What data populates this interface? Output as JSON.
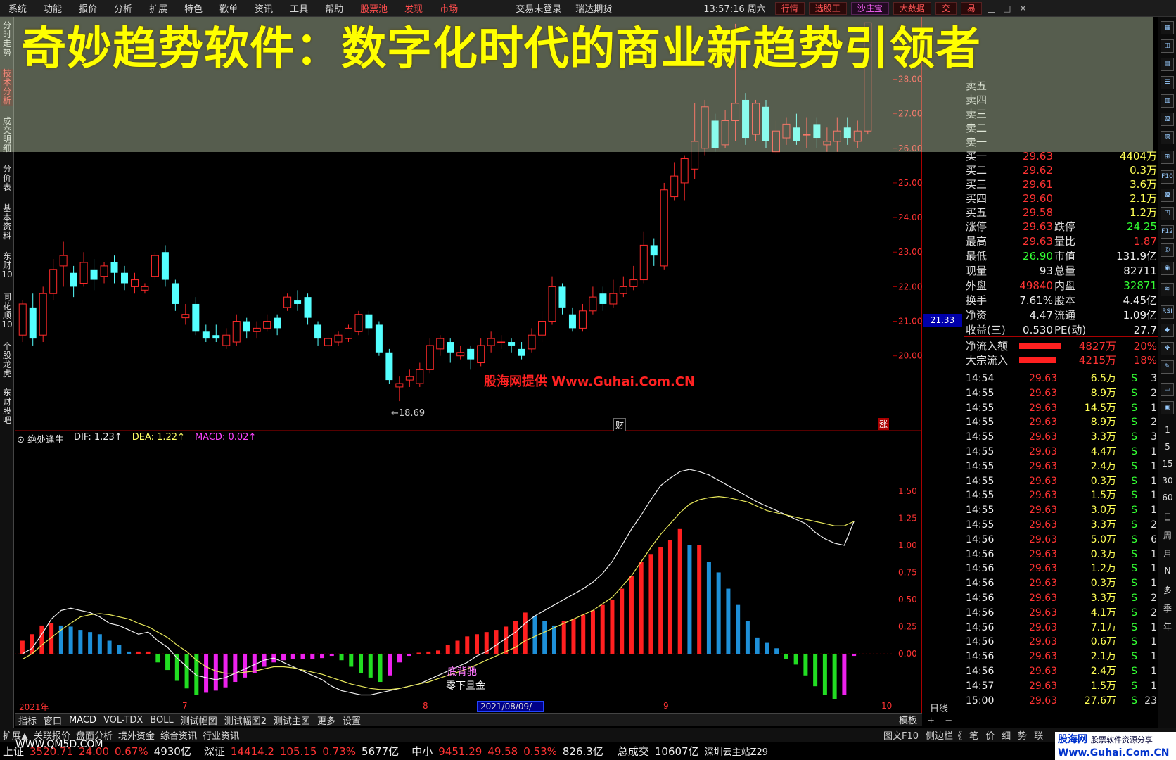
{
  "menu": {
    "items": [
      "系统",
      "功能",
      "报价",
      "分析",
      "扩展",
      "特色",
      "歡单",
      "资讯",
      "工具",
      "帮助"
    ],
    "red_items": [
      "股票池",
      "发现",
      "市场"
    ],
    "center": [
      "交易未登录",
      "瑞达期货"
    ],
    "time": "13:57:16 周六",
    "right_buttons": [
      "行情",
      "选股王",
      "沙庄宝",
      "大数据",
      "交",
      "易"
    ]
  },
  "left_tabs": [
    "分时走势",
    "技术分析",
    "成交明细",
    "分价表",
    "基本资料",
    "东财10",
    "同花顺10",
    "个股龙虎",
    "东财股吧"
  ],
  "title_overlay": "奇妙趋势软件：数字化时代的商业新趋势引领者",
  "price_axis": [
    "28.00",
    "27.00",
    "26.00",
    "25.00",
    "24.00",
    "23.00",
    "22.00",
    "21.00",
    "20.00"
  ],
  "current_price_tag": "21.33",
  "low_label": "←18.69",
  "watermark": "股海网提供 Www.Guhai.Com.CN",
  "finance_markers": {
    "cai": "财",
    "zhang": "涨"
  },
  "indicator": {
    "name": "绝处逢生",
    "dif": "DIF: 1.23↑",
    "dea": "DEA: 1.22↑",
    "macd": "MACD: 0.02↑",
    "axis": [
      "1.50",
      "1.25",
      "1.00",
      "0.75",
      "0.50",
      "0.25",
      "0.00"
    ],
    "signal1": "底背驰",
    "signal2": "零下旦金"
  },
  "x_axis": {
    "labels": [
      "2021年",
      "7",
      "8",
      "9",
      "10"
    ],
    "cursor_date": "2021/08/09/—",
    "period": "日线"
  },
  "bottom_tabs": [
    "指标",
    "窗口",
    "MACD",
    "VOL-TDX",
    "BOLL",
    "测试幅图",
    "测试幅图2",
    "测试主图",
    "更多",
    "设置"
  ],
  "template_controls": [
    "模板",
    "+",
    "−"
  ],
  "status_tabs": [
    "扩展▲",
    "关联报价",
    "盘面分析",
    "境外资金",
    "综合资讯",
    "行业资讯"
  ],
  "status_right": [
    "图文F10",
    "侧边栏《",
    "笔",
    "价",
    "细",
    "势",
    "联"
  ],
  "index_bar": [
    {
      "name": "上证",
      "value": "3520.71",
      "chg": "24.00",
      "pct": "0.67%",
      "amt": "4930亿"
    },
    {
      "name": "深证",
      "value": "14414.2",
      "chg": "105.15",
      "pct": "0.73%",
      "amt": "5677亿"
    },
    {
      "name": "中小",
      "value": "9451.29",
      "chg": "49.58",
      "pct": "0.53%",
      "amt": "826.3亿"
    }
  ],
  "total_trade": {
    "label": "总成交",
    "value": "10607亿",
    "server": "深圳云主站Z29"
  },
  "site_mark": "WWW.QM5D.COM",
  "guhai_logo": {
    "line1": "股海网",
    "line2": "股票软件资源分享",
    "line3": "Www.Guhai.Com.CN"
  },
  "quote": {
    "sell": [
      {
        "label": "卖五",
        "price": "",
        "vol": ""
      },
      {
        "label": "卖四",
        "price": "",
        "vol": ""
      },
      {
        "label": "卖三",
        "price": "",
        "vol": ""
      },
      {
        "label": "卖二",
        "price": "",
        "vol": ""
      },
      {
        "label": "卖一",
        "price": "",
        "vol": ""
      }
    ],
    "buy": [
      {
        "label": "买一",
        "price": "29.63",
        "vol": "4404万"
      },
      {
        "label": "买二",
        "price": "29.62",
        "vol": "0.3万"
      },
      {
        "label": "买三",
        "price": "29.61",
        "vol": "3.6万"
      },
      {
        "label": "买四",
        "price": "29.60",
        "vol": "2.1万"
      },
      {
        "label": "买五",
        "price": "29.58",
        "vol": "1.2万"
      }
    ],
    "stats": [
      {
        "l1": "涨停",
        "v1": "29.63",
        "l2": "跌停",
        "v2": "24.25",
        "c1": "red",
        "c2": "green"
      },
      {
        "l1": "最高",
        "v1": "29.63",
        "l2": "量比",
        "v2": "1.87",
        "c1": "red",
        "c2": "red"
      },
      {
        "l1": "最低",
        "v1": "26.90",
        "l2": "市值",
        "v2": "131.9亿",
        "c1": "green",
        "c2": "white"
      },
      {
        "l1": "现量",
        "v1": "93",
        "l2": "总量",
        "v2": "82711",
        "c1": "white",
        "c2": "white"
      },
      {
        "l1": "外盘",
        "v1": "49840",
        "l2": "内盘",
        "v2": "32871",
        "c1": "red",
        "c2": "green"
      },
      {
        "l1": "换手",
        "v1": "7.61%",
        "l2": "股本",
        "v2": "4.45亿",
        "c1": "white",
        "c2": "white"
      },
      {
        "l1": "净资",
        "v1": "4.47",
        "l2": "流通",
        "v2": "1.09亿",
        "c1": "white",
        "c2": "white"
      },
      {
        "l1": "收益(三)",
        "v1": "0.530",
        "l2": "PE(动)",
        "v2": "27.7",
        "c1": "white",
        "c2": "white"
      }
    ],
    "flows": [
      {
        "label": "净流入额",
        "value": "4827万",
        "pct": "20%",
        "bar": 0.9
      },
      {
        "label": "大宗流入",
        "value": "4215万",
        "pct": "18%",
        "bar": 0.8
      }
    ],
    "ticks": [
      {
        "t": "14:54",
        "p": "29.63",
        "v": "6.5万",
        "bs": "S",
        "n": "3"
      },
      {
        "t": "14:55",
        "p": "29.63",
        "v": "8.9万",
        "bs": "S",
        "n": "2"
      },
      {
        "t": "14:55",
        "p": "29.63",
        "v": "14.5万",
        "bs": "S",
        "n": "1"
      },
      {
        "t": "14:55",
        "p": "29.63",
        "v": "8.9万",
        "bs": "S",
        "n": "2"
      },
      {
        "t": "14:55",
        "p": "29.63",
        "v": "3.3万",
        "bs": "S",
        "n": "3"
      },
      {
        "t": "14:55",
        "p": "29.63",
        "v": "4.4万",
        "bs": "S",
        "n": "1"
      },
      {
        "t": "14:55",
        "p": "29.63",
        "v": "2.4万",
        "bs": "S",
        "n": "1"
      },
      {
        "t": "14:55",
        "p": "29.63",
        "v": "0.3万",
        "bs": "S",
        "n": "1"
      },
      {
        "t": "14:55",
        "p": "29.63",
        "v": "1.5万",
        "bs": "S",
        "n": "1"
      },
      {
        "t": "14:55",
        "p": "29.63",
        "v": "3.0万",
        "bs": "S",
        "n": "1"
      },
      {
        "t": "14:55",
        "p": "29.63",
        "v": "3.3万",
        "bs": "S",
        "n": "2"
      },
      {
        "t": "14:56",
        "p": "29.63",
        "v": "5.0万",
        "bs": "S",
        "n": "6"
      },
      {
        "t": "14:56",
        "p": "29.63",
        "v": "0.3万",
        "bs": "S",
        "n": "1"
      },
      {
        "t": "14:56",
        "p": "29.63",
        "v": "1.2万",
        "bs": "S",
        "n": "1"
      },
      {
        "t": "14:56",
        "p": "29.63",
        "v": "0.3万",
        "bs": "S",
        "n": "1"
      },
      {
        "t": "14:56",
        "p": "29.63",
        "v": "3.3万",
        "bs": "S",
        "n": "2"
      },
      {
        "t": "14:56",
        "p": "29.63",
        "v": "4.1万",
        "bs": "S",
        "n": "2"
      },
      {
        "t": "14:56",
        "p": "29.63",
        "v": "7.1万",
        "bs": "S",
        "n": "1"
      },
      {
        "t": "14:56",
        "p": "29.63",
        "v": "0.6万",
        "bs": "S",
        "n": "1"
      },
      {
        "t": "14:56",
        "p": "29.63",
        "v": "2.1万",
        "bs": "S",
        "n": "1"
      },
      {
        "t": "14:56",
        "p": "29.63",
        "v": "2.4万",
        "bs": "S",
        "n": "1"
      },
      {
        "t": "14:57",
        "p": "29.63",
        "v": "1.5万",
        "bs": "S",
        "n": "1"
      },
      {
        "t": "15:00",
        "p": "29.63",
        "v": "27.6万",
        "bs": "S",
        "n": "23"
      }
    ]
  },
  "right_tools": [
    "F10",
    "F12",
    "RSI"
  ],
  "right_periods": [
    "1",
    "5",
    "15",
    "30",
    "60",
    "日",
    "周",
    "月",
    "N",
    "多",
    "季",
    "年"
  ],
  "chart_data": {
    "type": "candlestick",
    "ylim": [
      18.0,
      29.8
    ],
    "candles": [
      [
        20.6,
        21.5,
        20.4,
        21.6
      ],
      [
        21.4,
        20.5,
        20.3,
        21.8
      ],
      [
        20.6,
        21.8,
        20.4,
        22.0
      ],
      [
        21.8,
        22.5,
        21.6,
        22.8
      ],
      [
        22.6,
        22.9,
        22.0,
        23.3
      ],
      [
        22.4,
        22.0,
        21.7,
        22.6
      ],
      [
        22.1,
        22.7,
        22.0,
        23.0
      ],
      [
        22.5,
        22.2,
        21.9,
        22.8
      ],
      [
        22.3,
        22.6,
        22.1,
        22.7
      ],
      [
        22.7,
        22.4,
        22.1,
        22.9
      ],
      [
        22.4,
        22.1,
        21.9,
        22.6
      ],
      [
        22.0,
        22.2,
        21.8,
        22.4
      ],
      [
        21.9,
        22.0,
        21.8,
        22.1
      ],
      [
        22.3,
        22.9,
        22.2,
        23.0
      ],
      [
        23.0,
        22.2,
        22.0,
        23.2
      ],
      [
        22.1,
        21.5,
        21.3,
        22.2
      ],
      [
        21.1,
        21.2,
        20.9,
        21.5
      ],
      [
        21.5,
        20.7,
        20.6,
        21.7
      ],
      [
        20.7,
        20.5,
        20.4,
        20.9
      ],
      [
        20.6,
        20.5,
        20.4,
        20.9
      ],
      [
        20.3,
        20.6,
        20.2,
        20.8
      ],
      [
        20.4,
        21.0,
        20.3,
        21.2
      ],
      [
        21.0,
        20.7,
        20.5,
        21.1
      ],
      [
        20.7,
        20.8,
        20.5,
        21.0
      ],
      [
        20.8,
        21.0,
        20.7,
        21.2
      ],
      [
        21.1,
        20.8,
        20.6,
        21.2
      ],
      [
        21.4,
        21.7,
        21.3,
        21.8
      ],
      [
        21.6,
        21.5,
        21.3,
        21.9
      ],
      [
        21.7,
        21.1,
        20.9,
        21.8
      ],
      [
        20.9,
        20.5,
        20.3,
        21.0
      ],
      [
        20.3,
        20.5,
        20.2,
        20.6
      ],
      [
        20.4,
        20.6,
        20.3,
        20.7
      ],
      [
        20.5,
        20.8,
        20.4,
        20.9
      ],
      [
        20.7,
        21.2,
        20.6,
        21.3
      ],
      [
        21.2,
        20.8,
        20.6,
        21.3
      ],
      [
        20.9,
        20.1,
        20.0,
        21.0
      ],
      [
        20.1,
        19.3,
        19.2,
        20.2
      ],
      [
        19.1,
        19.2,
        18.69,
        19.4
      ],
      [
        19.3,
        19.4,
        19.1,
        19.6
      ],
      [
        19.2,
        19.6,
        19.1,
        19.8
      ],
      [
        19.6,
        20.3,
        19.5,
        20.5
      ],
      [
        20.2,
        20.5,
        20.0,
        20.6
      ],
      [
        20.4,
        20.1,
        19.8,
        20.5
      ],
      [
        20.0,
        20.1,
        19.9,
        20.3
      ],
      [
        20.2,
        19.9,
        19.6,
        20.3
      ],
      [
        19.8,
        20.3,
        19.7,
        20.5
      ],
      [
        20.3,
        20.5,
        20.1,
        20.7
      ],
      [
        20.4,
        20.4,
        20.2,
        20.6
      ],
      [
        20.4,
        20.3,
        20.1,
        20.5
      ],
      [
        20.2,
        20.0,
        19.9,
        20.4
      ],
      [
        20.2,
        20.6,
        20.1,
        20.8
      ],
      [
        20.6,
        21.0,
        20.4,
        21.3
      ],
      [
        21.0,
        22.0,
        20.9,
        22.3
      ],
      [
        22.0,
        21.4,
        21.2,
        22.1
      ],
      [
        21.2,
        20.8,
        20.7,
        21.4
      ],
      [
        20.8,
        21.3,
        20.7,
        21.5
      ],
      [
        21.3,
        21.7,
        21.2,
        22.0
      ],
      [
        21.8,
        21.5,
        21.3,
        22.0
      ],
      [
        21.5,
        21.8,
        21.4,
        22.2
      ],
      [
        21.8,
        22.0,
        21.7,
        22.3
      ],
      [
        22.0,
        22.2,
        21.9,
        22.6
      ],
      [
        22.2,
        23.2,
        22.1,
        23.6
      ],
      [
        23.2,
        22.9,
        22.6,
        23.4
      ],
      [
        22.6,
        24.8,
        22.5,
        25.0
      ],
      [
        24.6,
        25.2,
        24.5,
        25.6
      ],
      [
        25.0,
        25.7,
        24.5,
        25.8
      ],
      [
        25.4,
        26.2,
        25.1,
        27.3
      ],
      [
        26.0,
        27.2,
        25.8,
        27.4
      ],
      [
        26.8,
        26.0,
        25.9,
        27.0
      ],
      [
        26.1,
        26.8,
        26.0,
        27.1
      ],
      [
        26.8,
        27.3,
        26.2,
        29.6
      ],
      [
        27.4,
        26.3,
        26.1,
        27.6
      ],
      [
        26.4,
        27.3,
        26.2,
        27.4
      ],
      [
        27.2,
        26.2,
        26.0,
        27.4
      ],
      [
        25.9,
        26.5,
        25.8,
        26.8
      ],
      [
        26.3,
        26.7,
        26.1,
        26.9
      ],
      [
        26.6,
        26.2,
        26.1,
        27.0
      ],
      [
        26.4,
        26.4,
        26.0,
        26.9
      ],
      [
        26.7,
        26.3,
        26.0,
        26.9
      ],
      [
        26.1,
        26.2,
        25.9,
        26.6
      ],
      [
        26.2,
        26.5,
        25.9,
        26.9
      ],
      [
        26.6,
        26.3,
        26.1,
        26.9
      ],
      [
        26.2,
        26.5,
        26.0,
        26.8
      ],
      [
        26.5,
        29.63,
        26.4,
        29.63
      ]
    ],
    "macd_hist": [
      0.12,
      0.18,
      0.26,
      0.28,
      0.26,
      0.25,
      0.22,
      0.2,
      0.18,
      0.12,
      0.08,
      0.02,
      0.02,
      0.02,
      -0.08,
      -0.15,
      -0.25,
      -0.32,
      -0.38,
      -0.36,
      -0.34,
      -0.31,
      -0.26,
      -0.22,
      -0.18,
      -0.12,
      -0.08,
      -0.06,
      -0.05,
      -0.05,
      -0.05,
      -0.04,
      -0.02,
      -0.06,
      -0.12,
      -0.18,
      -0.22,
      -0.26,
      -0.2,
      -0.08,
      -0.02,
      0.01,
      0.02,
      0.03,
      0.08,
      0.12,
      0.16,
      0.18,
      0.2,
      0.22,
      0.25,
      0.3,
      0.38,
      0.35,
      0.3,
      0.26,
      0.3,
      0.32,
      0.36,
      0.4,
      0.45,
      0.5,
      0.6,
      0.72,
      0.85,
      0.92,
      0.98,
      1.05,
      1.15,
      1.0,
      1.0,
      0.85,
      0.75,
      0.6,
      0.45,
      0.3,
      0.15,
      0.1,
      0.05,
      -0.05,
      -0.1,
      -0.2,
      -0.3,
      -0.38,
      -0.42,
      -0.38,
      -0.02
    ],
    "dif": [
      0.0,
      0.05,
      0.18,
      0.32,
      0.4,
      0.42,
      0.4,
      0.38,
      0.34,
      0.28,
      0.26,
      0.22,
      0.18,
      0.2,
      0.12,
      0.06,
      -0.04,
      -0.12,
      -0.2,
      -0.22,
      -0.24,
      -0.22,
      -0.18,
      -0.14,
      -0.1,
      -0.06,
      -0.04,
      -0.08,
      -0.12,
      -0.16,
      -0.2,
      -0.24,
      -0.3,
      -0.34,
      -0.36,
      -0.38,
      -0.38,
      -0.36,
      -0.34,
      -0.32,
      -0.3,
      -0.28,
      -0.24,
      -0.2,
      -0.16,
      -0.12,
      -0.08,
      -0.02,
      0.02,
      0.08,
      0.14,
      0.2,
      0.28,
      0.35,
      0.4,
      0.45,
      0.5,
      0.55,
      0.6,
      0.66,
      0.74,
      0.85,
      1.0,
      1.15,
      1.28,
      1.42,
      1.55,
      1.62,
      1.68,
      1.7,
      1.68,
      1.65,
      1.6,
      1.55,
      1.5,
      1.45,
      1.4,
      1.36,
      1.32,
      1.28,
      1.24,
      1.2,
      1.12,
      1.06,
      1.02,
      1.0,
      1.22
    ],
    "dea": [
      -0.05,
      0.0,
      0.08,
      0.15,
      0.22,
      0.28,
      0.34,
      0.36,
      0.37,
      0.36,
      0.34,
      0.32,
      0.28,
      0.25,
      0.2,
      0.15,
      0.08,
      0.02,
      -0.06,
      -0.12,
      -0.16,
      -0.18,
      -0.18,
      -0.17,
      -0.16,
      -0.14,
      -0.12,
      -0.12,
      -0.13,
      -0.15,
      -0.17,
      -0.19,
      -0.22,
      -0.25,
      -0.28,
      -0.3,
      -0.32,
      -0.33,
      -0.33,
      -0.32,
      -0.3,
      -0.28,
      -0.26,
      -0.23,
      -0.2,
      -0.17,
      -0.14,
      -0.1,
      -0.06,
      -0.02,
      0.02,
      0.06,
      0.12,
      0.16,
      0.2,
      0.24,
      0.28,
      0.32,
      0.36,
      0.4,
      0.46,
      0.52,
      0.62,
      0.72,
      0.85,
      0.98,
      1.1,
      1.2,
      1.3,
      1.38,
      1.42,
      1.44,
      1.45,
      1.44,
      1.42,
      1.4,
      1.36,
      1.32,
      1.3,
      1.28,
      1.26,
      1.24,
      1.22,
      1.2,
      1.18,
      1.18,
      1.22
    ],
    "macd_ylim": [
      -0.5,
      1.85
    ]
  }
}
